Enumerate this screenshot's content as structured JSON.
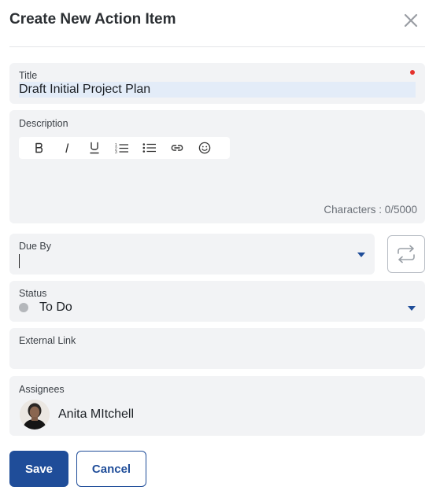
{
  "dialog": {
    "title": "Create New Action Item",
    "close_icon": "close-icon"
  },
  "fields": {
    "title": {
      "label": "Title",
      "value": "Draft Initial Project Plan",
      "required": true
    },
    "description": {
      "label": "Description",
      "value": "",
      "toolbar": [
        "bold-icon",
        "italic-icon",
        "underline-icon",
        "ordered-list-icon",
        "bullet-list-icon",
        "link-icon",
        "emoji-icon"
      ],
      "char_count": "Characters : 0/5000"
    },
    "due_by": {
      "label": "Due By",
      "value": "",
      "recurrence_icon": "repeat-icon"
    },
    "status": {
      "label": "Status",
      "value": "To Do",
      "dot_color": "#b4b7bb"
    },
    "external_link": {
      "label": "External Link",
      "value": ""
    },
    "assignees": {
      "label": "Assignees",
      "items": [
        {
          "name": "Anita MItchell"
        }
      ]
    }
  },
  "actions": {
    "save_label": "Save",
    "cancel_label": "Cancel"
  },
  "colors": {
    "accent": "#1f4d99",
    "required": "#e5322d",
    "field_bg": "#f2f3f5"
  }
}
